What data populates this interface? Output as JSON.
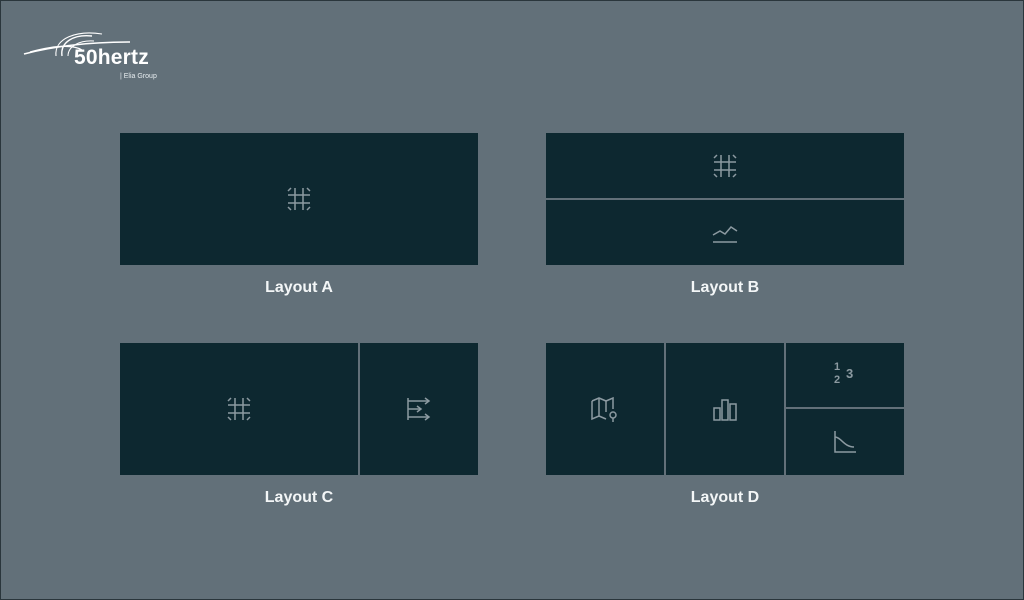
{
  "brand": {
    "name": "50hertz",
    "subtitle": "| Elia Group"
  },
  "layouts": [
    {
      "label": "Layout A",
      "panels": [
        "table-icon"
      ]
    },
    {
      "label": "Layout B",
      "panels": [
        "table-icon",
        "line-chart-icon"
      ]
    },
    {
      "label": "Layout C",
      "panels": [
        "table-icon",
        "flow-icon"
      ]
    },
    {
      "label": "Layout D",
      "panels": [
        "map-pin-icon",
        "bar-chart-icon",
        "numbers-icon",
        "decline-chart-icon"
      ]
    }
  ],
  "numbers_icon_text": {
    "top": "1",
    "bottom": "2",
    "right": "3"
  },
  "colors": {
    "background": "#627079",
    "tile": "#0d2830",
    "icon": "#8c9aa1",
    "text": "#f3f6f7"
  }
}
